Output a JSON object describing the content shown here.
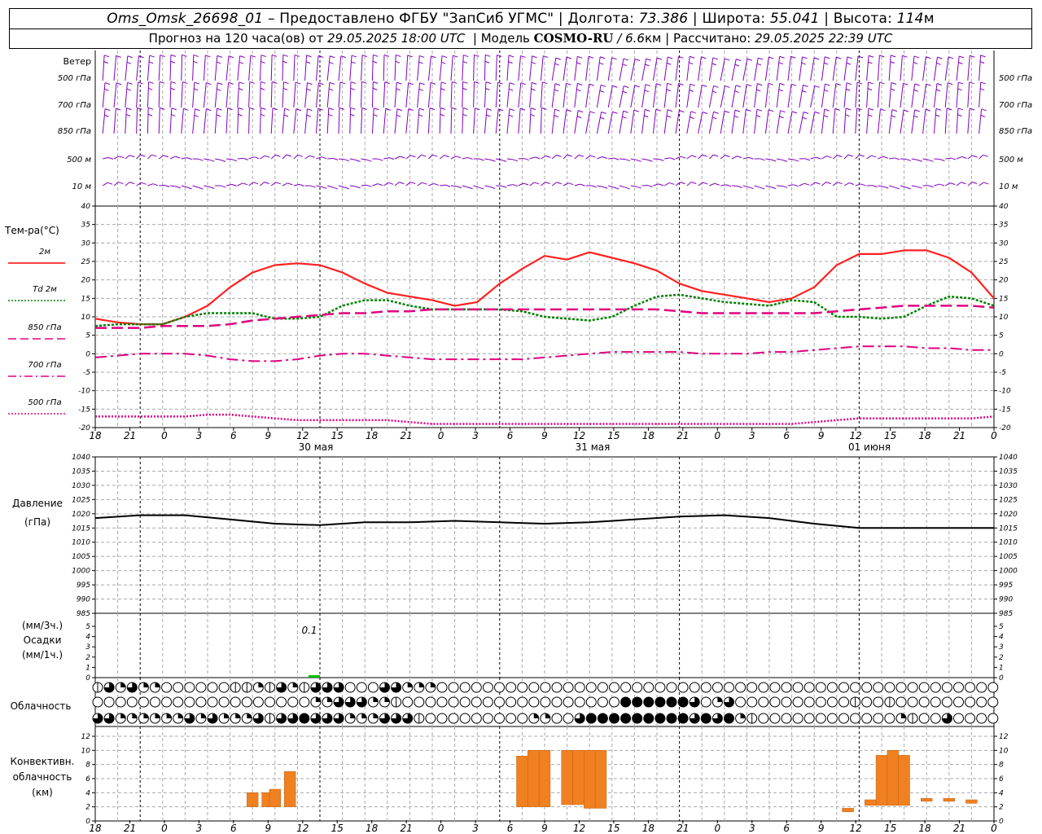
{
  "header": {
    "station": "Oms_Omsk_26698_01",
    "provided_by": "– Предоставлено ФГБУ \"ЗапСиб УГМС\"",
    "lon_label": "Долгота:",
    "lon": "73.386",
    "lat_label": "Широта:",
    "lat": "55.041",
    "alt_label": "Высота:",
    "alt": "114",
    "alt_unit": "м",
    "forecast_text": "Прогноз на 120 часа(ов) от",
    "forecast_start": "29.05.2025 18:00 UTC",
    "model_label": "Модель",
    "model": "COSMO-RU",
    "resolution": "/ 6.6",
    "res_unit": "км",
    "computed_label": "Рассчитано:",
    "computed": "29.05.2025 22:39 UTC"
  },
  "wind_panel": {
    "title": "Ветер",
    "levels_left": [
      "500 гПа",
      "700 гПа",
      "850 гПа",
      "500 м",
      "10 м"
    ],
    "levels_right": [
      "500 гПа",
      "700 гПа",
      "850 гПа",
      "500 м",
      "10 м"
    ],
    "color": "#8000c0"
  },
  "temp_panel": {
    "title": "Тем-ра(°С)",
    "legend": [
      {
        "label": "2м",
        "color": "#ff0000",
        "style": "solid"
      },
      {
        "label": "Td  2м",
        "color": "#008000",
        "style": "dotted"
      },
      {
        "label": "850 гПа",
        "color": "#e00080",
        "style": "dashed"
      },
      {
        "label": "700 гПа",
        "color": "#e00080",
        "style": "dashdot"
      },
      {
        "label": "500 гПа",
        "color": "#e00080",
        "style": "dotted"
      }
    ],
    "yticks": [
      "40",
      "35",
      "30",
      "25",
      "20",
      "15",
      "10",
      "5",
      "0",
      "-5",
      "-10",
      "-15",
      "-20"
    ]
  },
  "time_axis": {
    "hour_labels": [
      "18",
      "21",
      "0",
      "3",
      "6",
      "9",
      "12",
      "15",
      "18",
      "21",
      "0",
      "3",
      "6",
      "9",
      "12",
      "15",
      "18",
      "21",
      "0",
      "3",
      "6",
      "9",
      "12",
      "15",
      "18",
      "21",
      "0"
    ],
    "day_labels": [
      "30 мая",
      "31 мая",
      "01 июня"
    ]
  },
  "pressure_panel": {
    "title": "Давление",
    "unit": "(гПа)",
    "yticks": [
      "1040",
      "1035",
      "1030",
      "1025",
      "1020",
      "1015",
      "1010",
      "1005",
      "1000",
      "995",
      "990",
      "985"
    ]
  },
  "precip_panel": {
    "unit_left": "(мм/3ч.)",
    "title": "Осадки",
    "unit_right": "(мм/1ч.)",
    "yticks": [
      "5",
      "4",
      "3",
      "2",
      "1",
      "0"
    ],
    "annotation": "0.1"
  },
  "cloud_panel": {
    "title": "Облачность"
  },
  "conv_panel": {
    "title_line1": "Конвективн.",
    "title_line2": "облачность",
    "title_line3": "(км)",
    "yticks": [
      "12",
      "10",
      "8",
      "6",
      "4",
      "2",
      "0"
    ]
  },
  "chart_data": [
    {
      "type": "line",
      "title": "Тем-ра(°С)",
      "x_hours_from_start": [
        0,
        3,
        6,
        9,
        12,
        15,
        18,
        21,
        24,
        27,
        30,
        33,
        36,
        39,
        42,
        45,
        48,
        51,
        54,
        57,
        60,
        63,
        66,
        69,
        72,
        75,
        78,
        81,
        84,
        87,
        90,
        93,
        96,
        99,
        102,
        105,
        108,
        111,
        114,
        117,
        120
      ],
      "ylim": [
        -20,
        40
      ],
      "series": [
        {
          "name": "2м",
          "values": [
            9.5,
            8.5,
            8,
            8,
            10,
            13,
            18,
            22,
            24,
            24.5,
            24,
            22,
            19,
            16.5,
            15.5,
            14.5,
            13,
            14,
            19,
            23,
            26.5,
            25.5,
            27.5,
            26,
            24.5,
            22.5,
            19,
            17,
            16,
            15,
            14,
            15,
            18,
            24,
            27,
            27,
            28,
            28,
            26,
            22,
            15
          ]
        },
        {
          "name": "Td 2м",
          "values": [
            7.5,
            8,
            8,
            8,
            10,
            11,
            11,
            11,
            9.5,
            9.5,
            10,
            13,
            14.5,
            14.5,
            13,
            12,
            12,
            12,
            12,
            11.5,
            10,
            9.5,
            9,
            10,
            13,
            15.5,
            16,
            15,
            14,
            13.5,
            13,
            14.5,
            14,
            10,
            10,
            9.5,
            10,
            13,
            15.5,
            15,
            13
          ]
        },
        {
          "name": "850 гПа",
          "values": [
            7,
            7,
            7,
            7.5,
            7.5,
            7.5,
            8,
            9,
            9.5,
            10,
            10.5,
            11,
            11,
            11.5,
            11.5,
            12,
            12,
            12,
            12,
            12,
            12,
            12,
            12,
            12,
            12,
            12,
            11.5,
            11,
            11,
            11,
            11,
            11,
            11,
            11.5,
            12,
            12.5,
            13,
            13,
            13,
            13,
            12.5
          ]
        },
        {
          "name": "700 гПа",
          "values": [
            -1,
            -0.5,
            0,
            0,
            0,
            -0.5,
            -1.5,
            -2,
            -2,
            -1.5,
            -0.5,
            0,
            0,
            -0.5,
            -1,
            -1.5,
            -1.5,
            -1.5,
            -1.5,
            -1.5,
            -1,
            -0.5,
            0,
            0.5,
            0.5,
            0.5,
            0.5,
            0,
            0,
            0,
            0.5,
            0.5,
            1,
            1.5,
            2,
            2,
            2,
            1.5,
            1.5,
            1,
            1
          ]
        },
        {
          "name": "500 гПа",
          "values": [
            -17,
            -17,
            -17,
            -17,
            -17,
            -16.5,
            -16.5,
            -17,
            -17.5,
            -18,
            -18,
            -18,
            -18,
            -18,
            -18.5,
            -19,
            -19,
            -19,
            -19,
            -19,
            -19,
            -19,
            -19,
            -19,
            -19,
            -19,
            -19,
            -19,
            -19,
            -19,
            -19,
            -19,
            -18.5,
            -18,
            -17.5,
            -17.5,
            -17.5,
            -17.5,
            -17.5,
            -17.5,
            -17
          ]
        }
      ]
    },
    {
      "type": "line",
      "title": "Давление",
      "x_hours_from_start": [
        0,
        6,
        12,
        18,
        24,
        30,
        36,
        42,
        48,
        54,
        60,
        66,
        72,
        78,
        84,
        90,
        96,
        102,
        108,
        114,
        120
      ],
      "ylim": [
        985,
        1040
      ],
      "series": [
        {
          "name": "Давление",
          "values": [
            1018.5,
            1019.5,
            1019.5,
            1018,
            1016.5,
            1016,
            1017,
            1017,
            1017.5,
            1017,
            1016.5,
            1017,
            1018,
            1019,
            1019.5,
            1018.5,
            1016.5,
            1015,
            1015,
            1015,
            1015
          ]
        }
      ]
    },
    {
      "type": "bar",
      "title": "Осадки",
      "x_hours_from_start": [
        30
      ],
      "ylim": [
        0,
        5
      ],
      "values": [
        0.1
      ]
    },
    {
      "type": "bar",
      "title": "Конвективн. облачность (км)",
      "ylim": [
        0,
        12
      ],
      "bars": [
        {
          "h": 21,
          "base": 2,
          "top": 4
        },
        {
          "h": 23,
          "base": 2,
          "top": 4
        },
        {
          "h": 24,
          "base": 2,
          "top": 4.5
        },
        {
          "h": 26,
          "base": 2,
          "top": 7
        },
        {
          "h": 57,
          "base": 2,
          "top": 9.2
        },
        {
          "h": 58.5,
          "base": 2,
          "top": 10
        },
        {
          "h": 60,
          "base": 2,
          "top": 10
        },
        {
          "h": 63,
          "base": 2.3,
          "top": 10
        },
        {
          "h": 64.5,
          "base": 2.3,
          "top": 10
        },
        {
          "h": 66,
          "base": 1.8,
          "top": 10
        },
        {
          "h": 67.5,
          "base": 1.8,
          "top": 10
        },
        {
          "h": 100.5,
          "base": 1.3,
          "top": 1.8
        },
        {
          "h": 103.5,
          "base": 2.2,
          "top": 3
        },
        {
          "h": 105,
          "base": 2.2,
          "top": 9.3
        },
        {
          "h": 106.5,
          "base": 2.2,
          "top": 10
        },
        {
          "h": 108,
          "base": 2.2,
          "top": 9.3
        },
        {
          "h": 111,
          "base": 2.8,
          "top": 3.2
        },
        {
          "h": 114,
          "base": 2.8,
          "top": 3.2
        },
        {
          "h": 117,
          "base": 2.5,
          "top": 3
        }
      ]
    }
  ],
  "cloud_rows": {
    "low": [
      1,
      3,
      2,
      3,
      2,
      2,
      0,
      0,
      0,
      0,
      0,
      0,
      1,
      1,
      2,
      1,
      3,
      2,
      1,
      3,
      3,
      3,
      0,
      0,
      0,
      3,
      3,
      2,
      2,
      2,
      0,
      0,
      0,
      0,
      0,
      0,
      0,
      0,
      0,
      0,
      0,
      0,
      0,
      0,
      0,
      0,
      0,
      0,
      0,
      0,
      0,
      0,
      0,
      0,
      0,
      0,
      0,
      0,
      0,
      0,
      0,
      0,
      0,
      0,
      0,
      0,
      0,
      0,
      0,
      0,
      0,
      0,
      0,
      0,
      0,
      0,
      0,
      0,
      0,
      0,
      0,
      0
    ],
    "mid": [
      0,
      0,
      0,
      0,
      0,
      0,
      0,
      0,
      0,
      0,
      0,
      0,
      0,
      0,
      0,
      0,
      0,
      0,
      0,
      2,
      2,
      3,
      3,
      3,
      2,
      2,
      1,
      0,
      0,
      0,
      0,
      0,
      0,
      0,
      0,
      0,
      0,
      0,
      0,
      0,
      0,
      0,
      0,
      0,
      0,
      0,
      4,
      4,
      4,
      4,
      4,
      4,
      3,
      0,
      2,
      3,
      0,
      0,
      0,
      0,
      0,
      0,
      0,
      0,
      0,
      0,
      1,
      0,
      0,
      1,
      0,
      0,
      0,
      0,
      0,
      0,
      0,
      0,
      0,
      0,
      0,
      0
    ],
    "high": [
      3,
      3,
      2,
      2,
      2,
      2,
      2,
      2,
      3,
      2,
      3,
      2,
      2,
      2,
      3,
      1,
      3,
      3,
      4,
      3,
      3,
      3,
      2,
      2,
      2,
      3,
      3,
      3,
      1,
      0,
      0,
      0,
      0,
      0,
      0,
      0,
      0,
      0,
      2,
      2,
      0,
      0,
      3,
      4,
      4,
      4,
      4,
      4,
      4,
      4,
      4,
      4,
      3,
      4,
      3,
      4,
      2,
      1,
      0,
      0,
      0,
      0,
      0,
      0,
      0,
      0,
      0,
      0,
      0,
      0,
      2,
      1,
      0,
      0,
      3,
      0,
      0,
      0,
      0,
      0,
      0,
      0
    ]
  }
}
